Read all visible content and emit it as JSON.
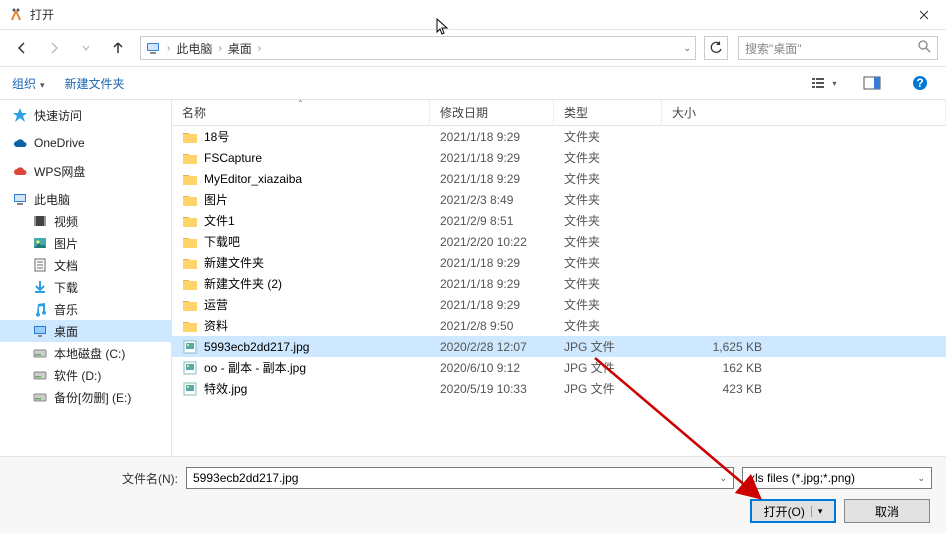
{
  "window": {
    "title": "打开"
  },
  "breadcrumb": {
    "items": [
      "此电脑",
      "桌面"
    ]
  },
  "search": {
    "placeholder": "搜索\"桌面\""
  },
  "toolbar": {
    "organize": "组织",
    "new_folder": "新建文件夹"
  },
  "columns": {
    "name": "名称",
    "date": "修改日期",
    "type": "类型",
    "size": "大小"
  },
  "sidebar": {
    "items": [
      {
        "label": "快速访问",
        "icon": "star",
        "color": "#2e9fe6",
        "indent": 0
      },
      {
        "label": "OneDrive",
        "icon": "cloud",
        "color": "#0a64a4",
        "indent": 0
      },
      {
        "label": "WPS网盘",
        "icon": "cloud",
        "color": "#d9483b",
        "indent": 0
      },
      {
        "label": "此电脑",
        "icon": "pc",
        "color": "#2e75d4",
        "indent": 0
      },
      {
        "label": "视频",
        "icon": "video",
        "color": "#555",
        "indent": 1
      },
      {
        "label": "图片",
        "icon": "picture",
        "color": "#3a8",
        "indent": 1
      },
      {
        "label": "文档",
        "icon": "doc",
        "color": "#555",
        "indent": 1
      },
      {
        "label": "下载",
        "icon": "download",
        "color": "#2e9fe6",
        "indent": 1
      },
      {
        "label": "音乐",
        "icon": "music",
        "color": "#2e9fe6",
        "indent": 1
      },
      {
        "label": "桌面",
        "icon": "desktop",
        "color": "#2e75d4",
        "indent": 1,
        "selected": true
      },
      {
        "label": "本地磁盘 (C:)",
        "icon": "disk",
        "color": "#888",
        "indent": 1
      },
      {
        "label": "软件 (D:)",
        "icon": "disk",
        "color": "#888",
        "indent": 1
      },
      {
        "label": "备份[勿删] (E:)",
        "icon": "disk",
        "color": "#888",
        "indent": 1
      }
    ]
  },
  "files": [
    {
      "name": "18号",
      "date": "2021/1/18 9:29",
      "type": "文件夹",
      "size": "",
      "kind": "folder"
    },
    {
      "name": "FSCapture",
      "date": "2021/1/18 9:29",
      "type": "文件夹",
      "size": "",
      "kind": "folder"
    },
    {
      "name": "MyEditor_xiazaiba",
      "date": "2021/1/18 9:29",
      "type": "文件夹",
      "size": "",
      "kind": "folder"
    },
    {
      "name": "图片",
      "date": "2021/2/3 8:49",
      "type": "文件夹",
      "size": "",
      "kind": "folder"
    },
    {
      "name": "文件1",
      "date": "2021/2/9 8:51",
      "type": "文件夹",
      "size": "",
      "kind": "folder"
    },
    {
      "name": "下载吧",
      "date": "2021/2/20 10:22",
      "type": "文件夹",
      "size": "",
      "kind": "folder"
    },
    {
      "name": "新建文件夹",
      "date": "2021/1/18 9:29",
      "type": "文件夹",
      "size": "",
      "kind": "folder"
    },
    {
      "name": "新建文件夹 (2)",
      "date": "2021/1/18 9:29",
      "type": "文件夹",
      "size": "",
      "kind": "folder"
    },
    {
      "name": "运营",
      "date": "2021/1/18 9:29",
      "type": "文件夹",
      "size": "",
      "kind": "folder"
    },
    {
      "name": "资料",
      "date": "2021/2/8 9:50",
      "type": "文件夹",
      "size": "",
      "kind": "folder"
    },
    {
      "name": "5993ecb2dd217.jpg",
      "date": "2020/2/28 12:07",
      "type": "JPG 文件",
      "size": "1,625 KB",
      "kind": "jpg",
      "selected": true
    },
    {
      "name": "oo - 副本 - 副本.jpg",
      "date": "2020/6/10 9:12",
      "type": "JPG 文件",
      "size": "162 KB",
      "kind": "jpg"
    },
    {
      "name": "特效.jpg",
      "date": "2020/5/19 10:33",
      "type": "JPG 文件",
      "size": "423 KB",
      "kind": "jpg"
    }
  ],
  "footer": {
    "filename_label": "文件名(N):",
    "filename_value": "5993ecb2dd217.jpg",
    "filter_value": "xls files (*.jpg;*.png)",
    "open_label": "打开(O)",
    "cancel_label": "取消"
  }
}
